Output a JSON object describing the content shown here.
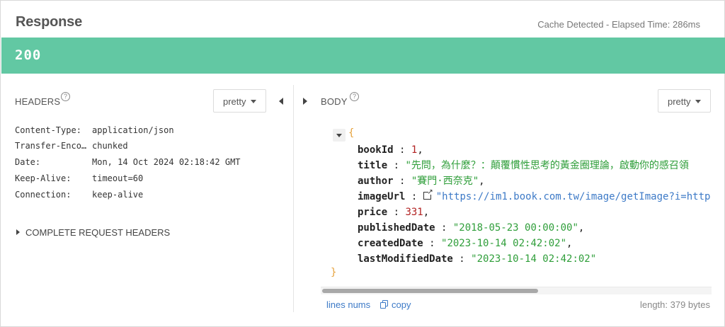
{
  "response": {
    "title": "Response",
    "meta": "Cache Detected - Elapsed Time: 286ms",
    "status_code": "200"
  },
  "headers_panel": {
    "label": "HEADERS",
    "help_glyph": "?",
    "format_select": "pretty",
    "rows": [
      {
        "key": "Content-Type:",
        "value": "application/json"
      },
      {
        "key": "Transfer-Enco…",
        "value": "chunked"
      },
      {
        "key": "Date:",
        "value": "Mon, 14 Oct 2024 02:18:42 GMT"
      },
      {
        "key": "Keep-Alive:",
        "value": "timeout=60"
      },
      {
        "key": "Connection:",
        "value": "keep-alive"
      }
    ],
    "complete_request_label": "COMPLETE REQUEST HEADERS"
  },
  "body_panel": {
    "label": "BODY",
    "help_glyph": "?",
    "format_select": "pretty",
    "json": {
      "open_brace": "{",
      "close_brace": "}",
      "fields": [
        {
          "key": "bookId",
          "value": "1",
          "type": "number"
        },
        {
          "key": "title",
          "value": "\"先問，為什麼？：顛覆慣性思考的黃金圈理論，啟動你的感召領",
          "type": "string"
        },
        {
          "key": "author",
          "value": "\"賽門·西奈克\"",
          "type": "string"
        },
        {
          "key": "imageUrl",
          "value": "\"https://im1.book.com.tw/image/getImage?i=http",
          "type": "link"
        },
        {
          "key": "price",
          "value": "331",
          "type": "number"
        },
        {
          "key": "publishedDate",
          "value": "\"2018-05-23 00:00:00\"",
          "type": "string"
        },
        {
          "key": "createdDate",
          "value": "\"2023-10-14 02:42:02\"",
          "type": "string"
        },
        {
          "key": "lastModifiedDate",
          "value": "\"2023-10-14 02:42:02\"",
          "type": "string"
        }
      ]
    },
    "scroll_position": 0,
    "footer": {
      "lines_nums": "lines nums",
      "copy": "copy",
      "length": "length: 379 bytes"
    }
  },
  "colors": {
    "status_bar": "#62c8a3",
    "json_key": "#222222",
    "json_number": "#b22222",
    "json_string": "#2f9e3a",
    "json_link": "#3d7ac7",
    "brace": "#e6a23c",
    "link": "#3d7ac7"
  }
}
